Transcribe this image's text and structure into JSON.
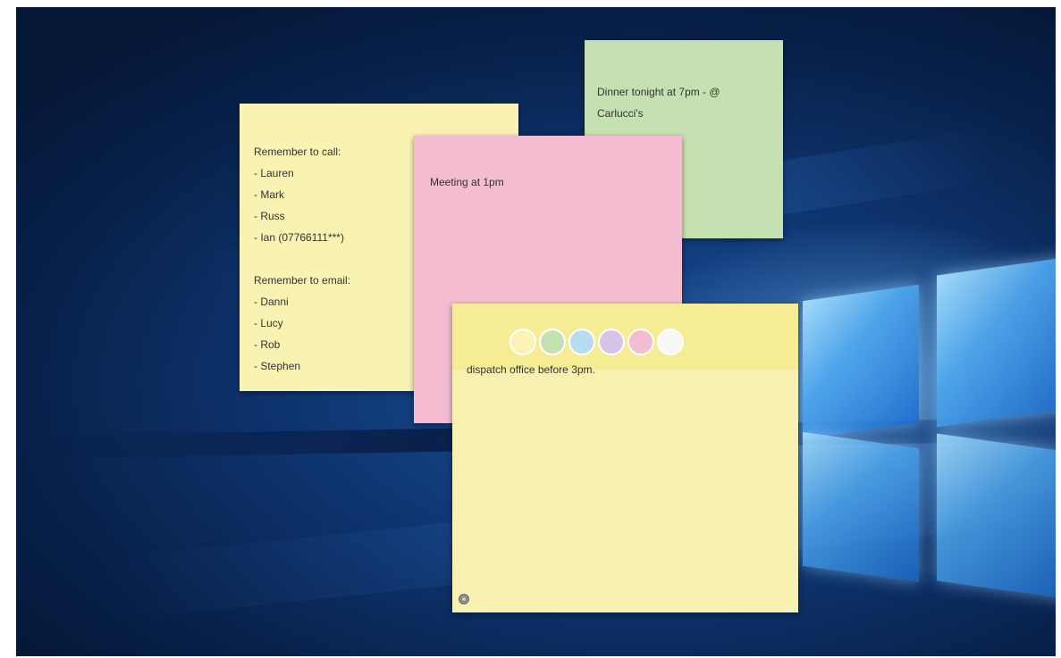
{
  "notes": {
    "green": {
      "color": "#c6e1b1",
      "lines": [
        "Dinner tonight at 7pm - @",
        "Carlucci's"
      ]
    },
    "yellow_list": {
      "color": "#f9f3b3",
      "call_heading": "Remember to call:",
      "call_items": [
        "- Lauren",
        "- Mark",
        "- Russ",
        "- Ian (07766111***)"
      ],
      "email_heading": "Remember to email:",
      "email_items": [
        "- Danni",
        "- Lucy",
        "- Rob",
        "- Stephen"
      ]
    },
    "pink": {
      "color": "#f3bcd0",
      "text": "Meeting at 1pm"
    },
    "yellow_active": {
      "color": "#f8f1b2",
      "toolbar_color": "#f5ec94",
      "text": "dispatch office before 3pm.",
      "color_options": [
        {
          "name": "yellow",
          "color": "#faf3b5"
        },
        {
          "name": "green",
          "color": "#c6e1b1"
        },
        {
          "name": "blue",
          "color": "#b7dcf0"
        },
        {
          "name": "purple",
          "color": "#d9c2e8"
        },
        {
          "name": "pink",
          "color": "#f3bcd0"
        },
        {
          "name": "white",
          "color": "#f8f8f8"
        }
      ]
    }
  }
}
